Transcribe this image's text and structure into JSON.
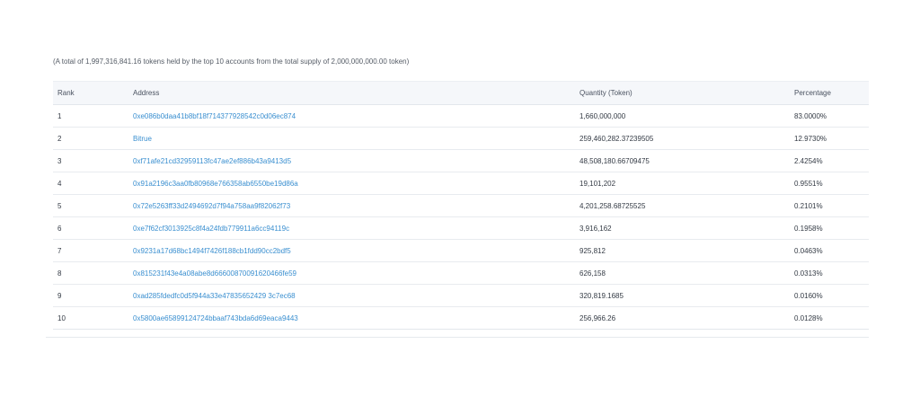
{
  "summary": "(A total of 1,997,316,841.16 tokens held by the top 10 accounts from the total supply of 2,000,000,000.00 token)",
  "table": {
    "headers": {
      "rank": "Rank",
      "address": "Address",
      "quantity": "Quantity (Token)",
      "percentage": "Percentage"
    },
    "rows": [
      {
        "rank": "1",
        "address": "0xe086b0daa41b8bf18f714377928542c0d06ec874",
        "quantity": "1,660,000,000",
        "percentage": "83.0000%"
      },
      {
        "rank": "2",
        "address": "Bitrue",
        "quantity": "259,460,282.37239505",
        "percentage": "12.9730%"
      },
      {
        "rank": "3",
        "address": "0xf71afe21cd32959113fc47ae2ef886b43a9413d5",
        "quantity": "48,508,180.66709475",
        "percentage": "2.4254%"
      },
      {
        "rank": "4",
        "address": "0x91a2196c3aa0fb80968e766358ab6550be19d86a",
        "quantity": "19,101,202",
        "percentage": "0.9551%"
      },
      {
        "rank": "5",
        "address": "0x72e5263ff33d2494692d7f94a758aa9f82062f73",
        "quantity": "4,201,258.68725525",
        "percentage": "0.2101%"
      },
      {
        "rank": "6",
        "address": "0xe7f62cf3013925c8f4a24fdb779911a6cc94119c",
        "quantity": "3,916,162",
        "percentage": "0.1958%"
      },
      {
        "rank": "7",
        "address": "0x9231a17d68bc1494f7426f188cb1fdd90cc2bdf5",
        "quantity": "925,812",
        "percentage": "0.0463%"
      },
      {
        "rank": "8",
        "address": "0x815231f43e4a08abe8d66600870091620466fe59",
        "quantity": "626,158",
        "percentage": "0.0313%"
      },
      {
        "rank": "9",
        "address": "0xad285fdedfc0d5f944a33e47835652429 3c7ec68",
        "quantity": "320,819.1685",
        "percentage": "0.0160%"
      },
      {
        "rank": "10",
        "address": "0x5800ae65899124724bbaaf743bda6d69eaca9443",
        "quantity": "256,966.26",
        "percentage": "0.0128%"
      }
    ]
  },
  "colors": {
    "link": "#3a8fd0",
    "header_bg": "#f5f7fa"
  }
}
